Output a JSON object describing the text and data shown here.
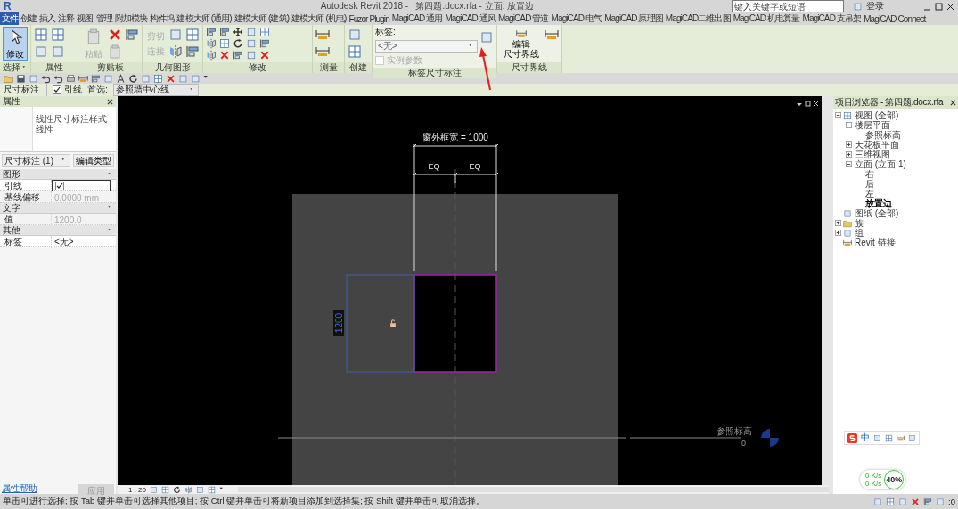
{
  "window": {
    "logo": "R",
    "title": "Autodesk Revit 2018 -   第四题.docx.rfa - 立面: 放置边",
    "search_placeholder": "键入关键字或短语",
    "sign_in": "登录"
  },
  "ribbon_tabs": [
    {
      "label": "文件",
      "kind": "file"
    },
    {
      "label": "创建",
      "kind": "tab"
    },
    {
      "label": "插入",
      "kind": "tab"
    },
    {
      "label": "注释",
      "kind": "tab"
    },
    {
      "label": "视图",
      "kind": "tab"
    },
    {
      "label": "管理",
      "kind": "tab"
    },
    {
      "label": "附加模块",
      "kind": "tab"
    },
    {
      "label": "构件坞",
      "kind": "tab"
    },
    {
      "label": "建模大师 (通用)",
      "kind": "tab"
    },
    {
      "label": "建模大师 (建筑)",
      "kind": "tab"
    },
    {
      "label": "建模大师 (机电)",
      "kind": "tab"
    },
    {
      "label": "Fuzor Plugin",
      "kind": "tab"
    },
    {
      "label": "MagiCAD 通用",
      "kind": "tab"
    },
    {
      "label": "MagiCAD 通风",
      "kind": "tab"
    },
    {
      "label": "MagiCAD 管道",
      "kind": "tab"
    },
    {
      "label": "MagiCAD 电气",
      "kind": "tab"
    },
    {
      "label": "MagiCAD 原理图",
      "kind": "tab"
    },
    {
      "label": "MagiCAD二维出图",
      "kind": "tab"
    },
    {
      "label": "MagiCAD 机电算量",
      "kind": "tab"
    },
    {
      "label": "MagiCAD 支吊架",
      "kind": "tab"
    },
    {
      "label": "MagiCAD Connect",
      "kind": "tab"
    }
  ],
  "ribbon": {
    "panels": [
      {
        "title": "选择",
        "has_menu": true,
        "large": {
          "label": "修改",
          "selected": true,
          "disabled": false
        }
      },
      {
        "title": "属性"
      },
      {
        "title": "剪贴板",
        "large": {
          "label": "粘贴",
          "selected": false,
          "disabled": true
        }
      },
      {
        "title": "几何图形",
        "rows": [
          {
            "label": "剪切",
            "disabled": true
          },
          {
            "label": "连接",
            "disabled": true
          }
        ]
      },
      {
        "title": "修改"
      },
      {
        "title": "测量"
      },
      {
        "title": "创建"
      },
      {
        "title": "标签尺寸标注",
        "field": {
          "label": "标签:",
          "value": "<无>",
          "checkbox_label": "实例参数",
          "checked": false,
          "disabled": true
        }
      },
      {
        "title": "尺寸界线",
        "large": {
          "lines": [
            "编辑",
            "尺寸界线"
          ],
          "selected": false,
          "disabled": false
        }
      }
    ]
  },
  "options_bar": {
    "context": "尺寸标注",
    "leader_label": "引线",
    "leader_checked": true,
    "prefer_label": "首选:",
    "prefer_value": "参照墙中心线"
  },
  "properties": {
    "title": "属性",
    "type_name": "线性尺寸标注样式",
    "type_subname": "线性",
    "instance_selector": "尺寸标注 (1)",
    "edit_type": "编辑类型",
    "groups": [
      {
        "title": "图形",
        "rows": [
          {
            "name": "引线",
            "kind": "checkbox",
            "checked": true
          },
          {
            "name": "基线偏移",
            "kind": "text",
            "value": "0.0000 mm",
            "disabled": true
          }
        ]
      },
      {
        "title": "文字",
        "rows": [
          {
            "name": "值",
            "kind": "text",
            "value": "1200.0",
            "disabled": true
          }
        ]
      },
      {
        "title": "其他",
        "rows": [
          {
            "name": "标签",
            "kind": "text",
            "value": "<无>",
            "disabled": false
          }
        ]
      }
    ],
    "help_link": "属性帮助",
    "apply": "应用"
  },
  "canvas": {
    "overall_dimension": "窗外框宽 = 1000",
    "eq_labels": [
      "EQ",
      "EQ"
    ],
    "temp_dimension": "1200",
    "level_name": "参照标高",
    "level_value": "0"
  },
  "view_bar": {
    "scale": "1 : 20"
  },
  "project_browser": {
    "title": "项目浏览器 - 第四题.docx.rfa",
    "tree": [
      {
        "label": "视图 (全部)",
        "expanded": true,
        "selected": false,
        "children": [
          {
            "label": "楼层平面",
            "expanded": true,
            "selected": false,
            "children": [
              {
                "label": "参照标高",
                "selected": false
              }
            ]
          },
          {
            "label": "天花板平面",
            "expanded": false,
            "selected": false
          },
          {
            "label": "三维视图",
            "expanded": false,
            "selected": false
          },
          {
            "label": "立面 (立面 1)",
            "expanded": true,
            "selected": false,
            "children": [
              {
                "label": "右",
                "selected": false
              },
              {
                "label": "后",
                "selected": false
              },
              {
                "label": "左",
                "selected": false
              },
              {
                "label": "放置边",
                "selected": true
              }
            ]
          }
        ]
      },
      {
        "label": "图纸 (全部)",
        "selected": false
      },
      {
        "label": "族",
        "expanded": false,
        "selected": false
      },
      {
        "label": "组",
        "expanded": false,
        "selected": false
      },
      {
        "label": "Revit 链接",
        "selected": false
      }
    ]
  },
  "ime_bar": {
    "mode": "中"
  },
  "net_monitor": {
    "upload": "0 K/s",
    "download": "0 K/s",
    "percent": "40%"
  },
  "status_bar": {
    "message": "单击可进行选择; 按 Tab 键并单击可选择其他项目; 按 Ctrl 键并单击可将新项目添加到选择集; 按 Shift 键并单击可取消选择。",
    "filter_count": ":0"
  }
}
